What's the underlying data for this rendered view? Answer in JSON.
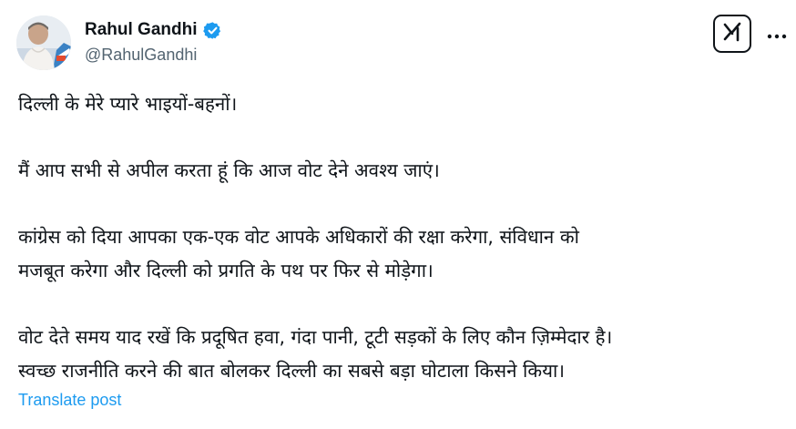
{
  "author": {
    "display_name": "Rahul Gandhi",
    "handle": "@RahulGandhi",
    "verified": true,
    "verified_color": "#1d9bf0"
  },
  "actions": {
    "grok_icon": "grok-icon",
    "more_icon": "more-icon"
  },
  "tweet": {
    "lines": [
      "दिल्ली के मेरे प्यारे भाइयों-बहनों।",
      "मैं आप सभी से अपील करता हूं कि आज वोट देने अवश्य जाएं।",
      "कांग्रेस को दिया आपका एक-एक वोट आपके अधिकारों की रक्षा करेगा, संविधान को",
      "मजबूत करेगा और दिल्ली को प्रगति के पथ पर फिर से मोड़ेगा।",
      "वोट देते समय याद रखें कि प्रदूषित हवा, गंदा पानी, टूटी सड़कों के लिए कौन ज़िम्मेदार है।",
      "स्वच्छ राजनीति करने की बात बोलकर दिल्ली का सबसे बड़ा घोटाला किसने किया।"
    ]
  },
  "translate": {
    "label": "Translate post",
    "color": "#1d9bf0"
  }
}
